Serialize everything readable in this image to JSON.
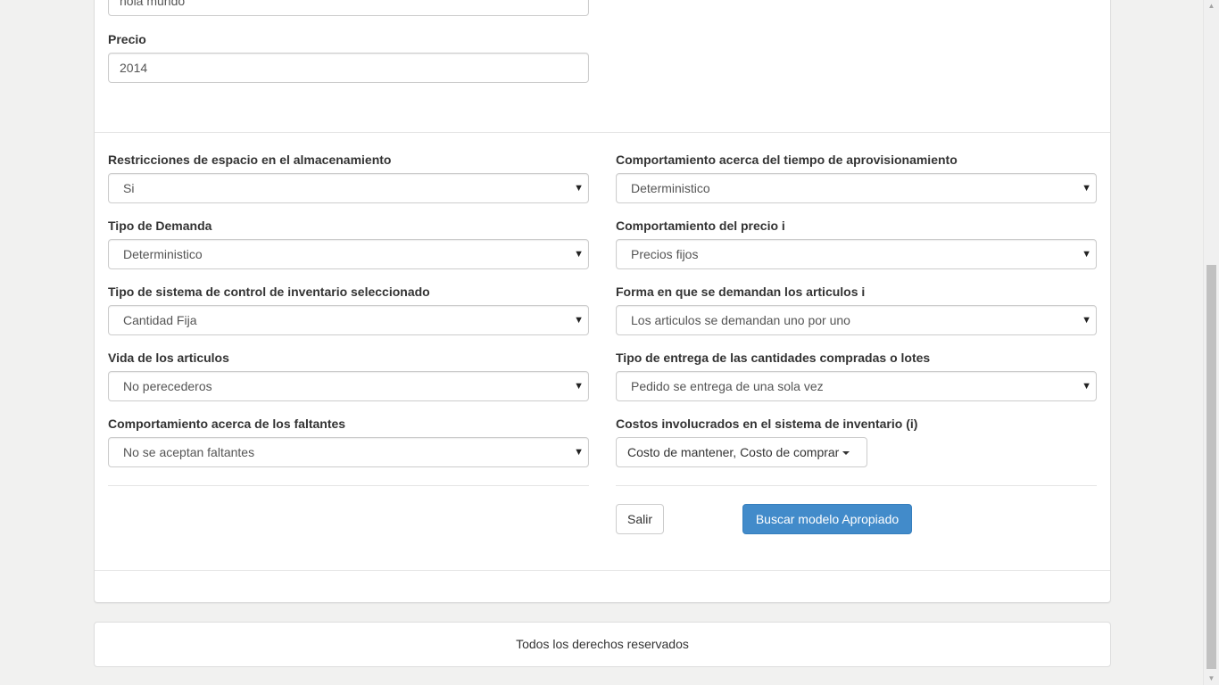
{
  "top_field": {
    "value": "hola mundo"
  },
  "precio": {
    "label": "Precio",
    "value": "2014"
  },
  "left_fields": [
    {
      "label": "Restricciones de espacio en el almacenamiento",
      "value": "Si"
    },
    {
      "label": "Tipo de Demanda",
      "value": "Deterministico"
    },
    {
      "label": "Tipo de sistema de control de inventario seleccionado",
      "value": "Cantidad Fija"
    },
    {
      "label": "Vida de los articulos",
      "value": "No perecederos"
    },
    {
      "label": "Comportamiento acerca de los faltantes",
      "value": "No se aceptan faltantes"
    }
  ],
  "right_fields": [
    {
      "label": "Comportamiento acerca del tiempo de aprovisionamiento",
      "value": "Deterministico"
    },
    {
      "label": "Comportamiento del precio i",
      "value": "Precios fijos"
    },
    {
      "label": "Forma en que se demandan los articulos i",
      "value": "Los articulos se demandan uno por uno"
    },
    {
      "label": "Tipo de entrega de las cantidades compradas o lotes",
      "value": "Pedido se entrega de una sola vez"
    }
  ],
  "costos": {
    "label": "Costos involucrados en el sistema de inventario (i)",
    "value": "Costo de mantener, Costo de comprar"
  },
  "buttons": {
    "salir": "Salir",
    "buscar": "Buscar modelo Apropiado"
  },
  "footer": {
    "text": "Todos los derechos reservados"
  },
  "icons": {
    "select_caret": "▼"
  },
  "colors": {
    "primary": "#428bca",
    "background": "#f1f1f0"
  }
}
